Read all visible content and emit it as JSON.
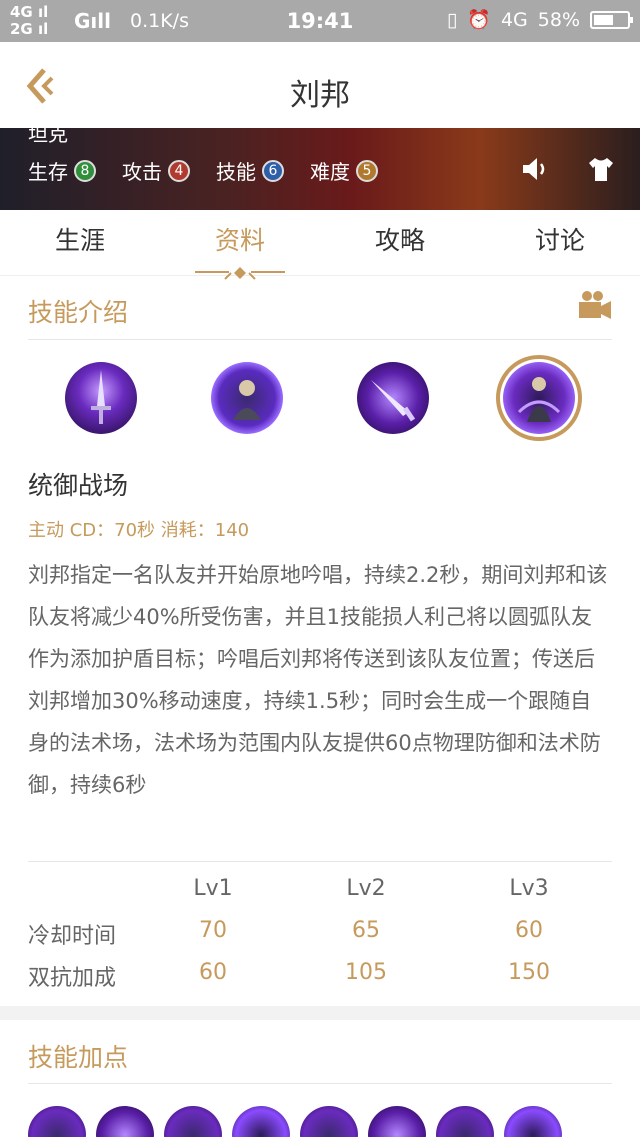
{
  "status_bar": {
    "net_top": "4G",
    "net_bottom": "2G",
    "net_g": "G",
    "speed": "0.1K/s",
    "time": "19:41",
    "net_right": "4G",
    "battery": "58%",
    "battery_level": 0.58
  },
  "header": {
    "title": "刘邦",
    "back_icon": "back-chevron-icon"
  },
  "hero": {
    "type_label": "坦克",
    "stats": [
      {
        "label": "生存",
        "value": "8",
        "color": "#2f8f3a"
      },
      {
        "label": "攻击",
        "value": "4",
        "color": "#b03a2e"
      },
      {
        "label": "技能",
        "value": "6",
        "color": "#2e5fa8"
      },
      {
        "label": "难度",
        "value": "5",
        "color": "#b07a2e"
      }
    ],
    "icons": [
      "speaker-icon",
      "shirt-icon"
    ]
  },
  "tabs": [
    {
      "label": "生涯"
    },
    {
      "label": "资料",
      "active": true
    },
    {
      "label": "攻略"
    },
    {
      "label": "讨论"
    }
  ],
  "skills_section": {
    "title": "技能介绍",
    "video_icon": "video-camera-icon",
    "skill": {
      "name": "统御战场",
      "meta": "主动 CD：70秒 消耗：140",
      "description": "刘邦指定一名队友并开始原地吟唱，持续2.2秒，期间刘邦和该队友将减少40%所受伤害，并且1技能损人利己将以圆弧队友作为添加护盾目标；吟唱后刘邦将传送到该队友位置；传送后刘邦增加30%移动速度，持续1.5秒；同时会生成一个跟随自身的法术场，法术场为范围内队友提供60点物理防御和法术防御，持续6秒"
    },
    "levels": {
      "headers": [
        "Lv1",
        "Lv2",
        "Lv3"
      ],
      "rows": [
        {
          "label": "冷却时间",
          "values": [
            "70",
            "65",
            "60"
          ]
        },
        {
          "label": "双抗加成",
          "values": [
            "60",
            "105",
            "150"
          ]
        }
      ]
    }
  },
  "points_section": {
    "title": "技能加点"
  },
  "colors": {
    "accent": "#c69a5c",
    "purple": "#6a2bbf"
  }
}
